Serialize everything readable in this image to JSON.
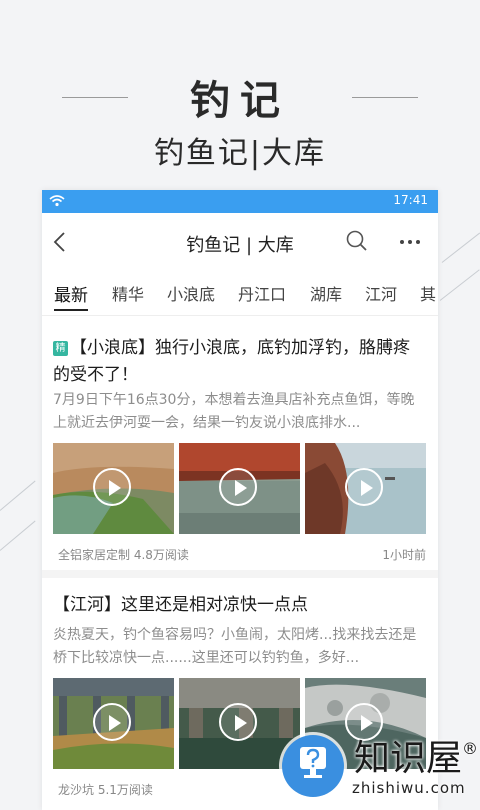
{
  "promo": {
    "title": "钓记",
    "subtitle": "钓鱼记|大库"
  },
  "status_bar": {
    "time": "17:41",
    "bar_color": "#3a9ef0"
  },
  "nav": {
    "title": "钓鱼记 | 大库",
    "back_icon": "chevron-left-icon",
    "search_icon": "search-icon",
    "more_icon": "more-icon"
  },
  "tabs": [
    {
      "label": "最新",
      "active": true
    },
    {
      "label": "精华",
      "active": false
    },
    {
      "label": "小浪底",
      "active": false
    },
    {
      "label": "丹江口",
      "active": false
    },
    {
      "label": "湖库",
      "active": false
    },
    {
      "label": "江河",
      "active": false
    },
    {
      "label": "其",
      "active": false
    }
  ],
  "articles": [
    {
      "tag": "精",
      "title": "【小浪底】独行小浪底，底钓加浮钓，胳膊疼的受不了！",
      "summary": "7月9日下午16点30分，本想着去渔具店补充点鱼饵，等晚上就近去伊河耍一会，结果一钓友说小浪底排水...",
      "author": "全铝家居定制",
      "reads": "4.8万阅读",
      "time": "1小时前"
    },
    {
      "title": "【江河】这里还是相对凉快一点点",
      "summary": "炎热夏天，钓个鱼容易吗？小鱼闹，太阳烤...找来找去还是桥下比较凉快一点......这里还可以钓钓鱼，多好...",
      "author": "龙沙坑",
      "reads": "5.1万阅读"
    }
  ],
  "watermark": {
    "brand": "知识屋",
    "reg": "®",
    "url": "zhishiwu.com"
  }
}
